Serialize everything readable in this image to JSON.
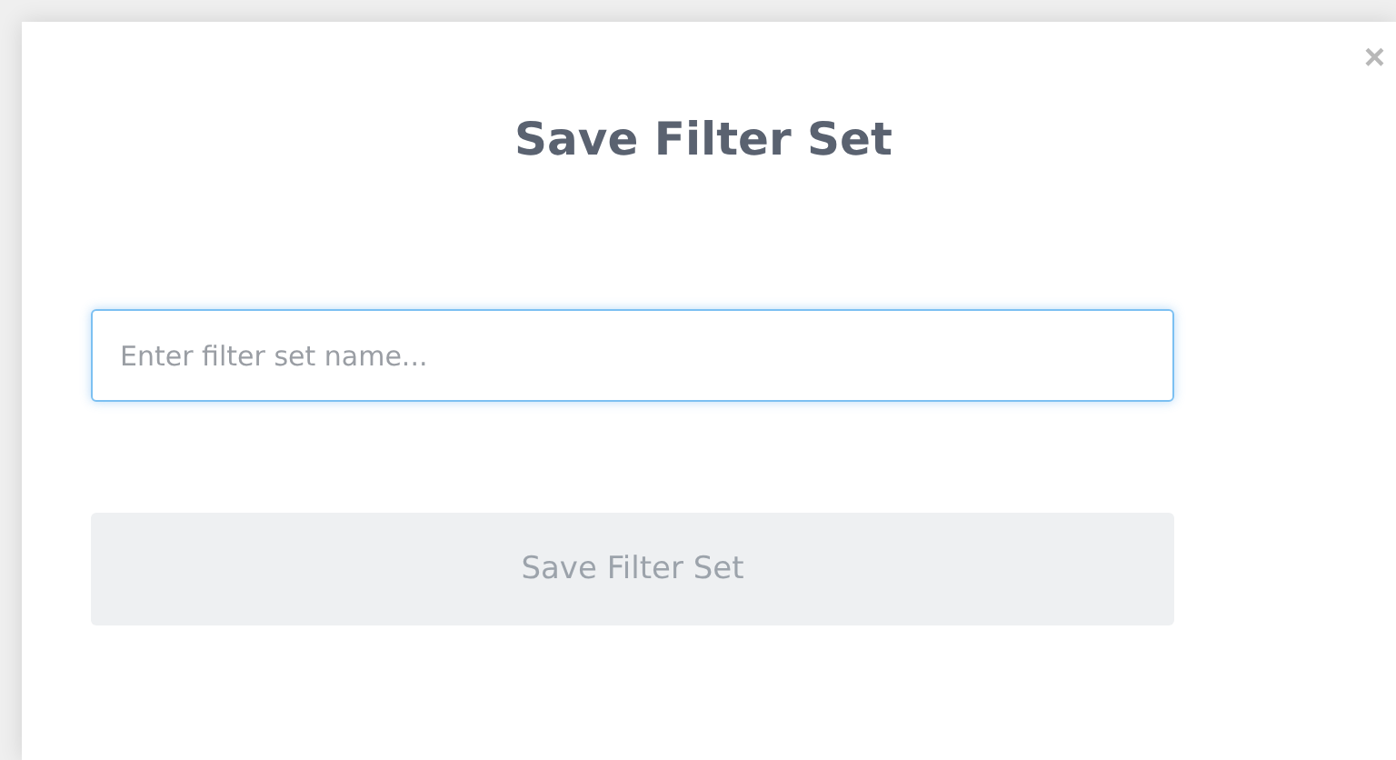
{
  "dialog": {
    "close": "×",
    "title": "Save Filter Set"
  },
  "name_field": {
    "placeholder": "Enter filter set name...",
    "focused": true
  },
  "save_button": {
    "label": "Save Filter Set",
    "disabled": true
  }
}
